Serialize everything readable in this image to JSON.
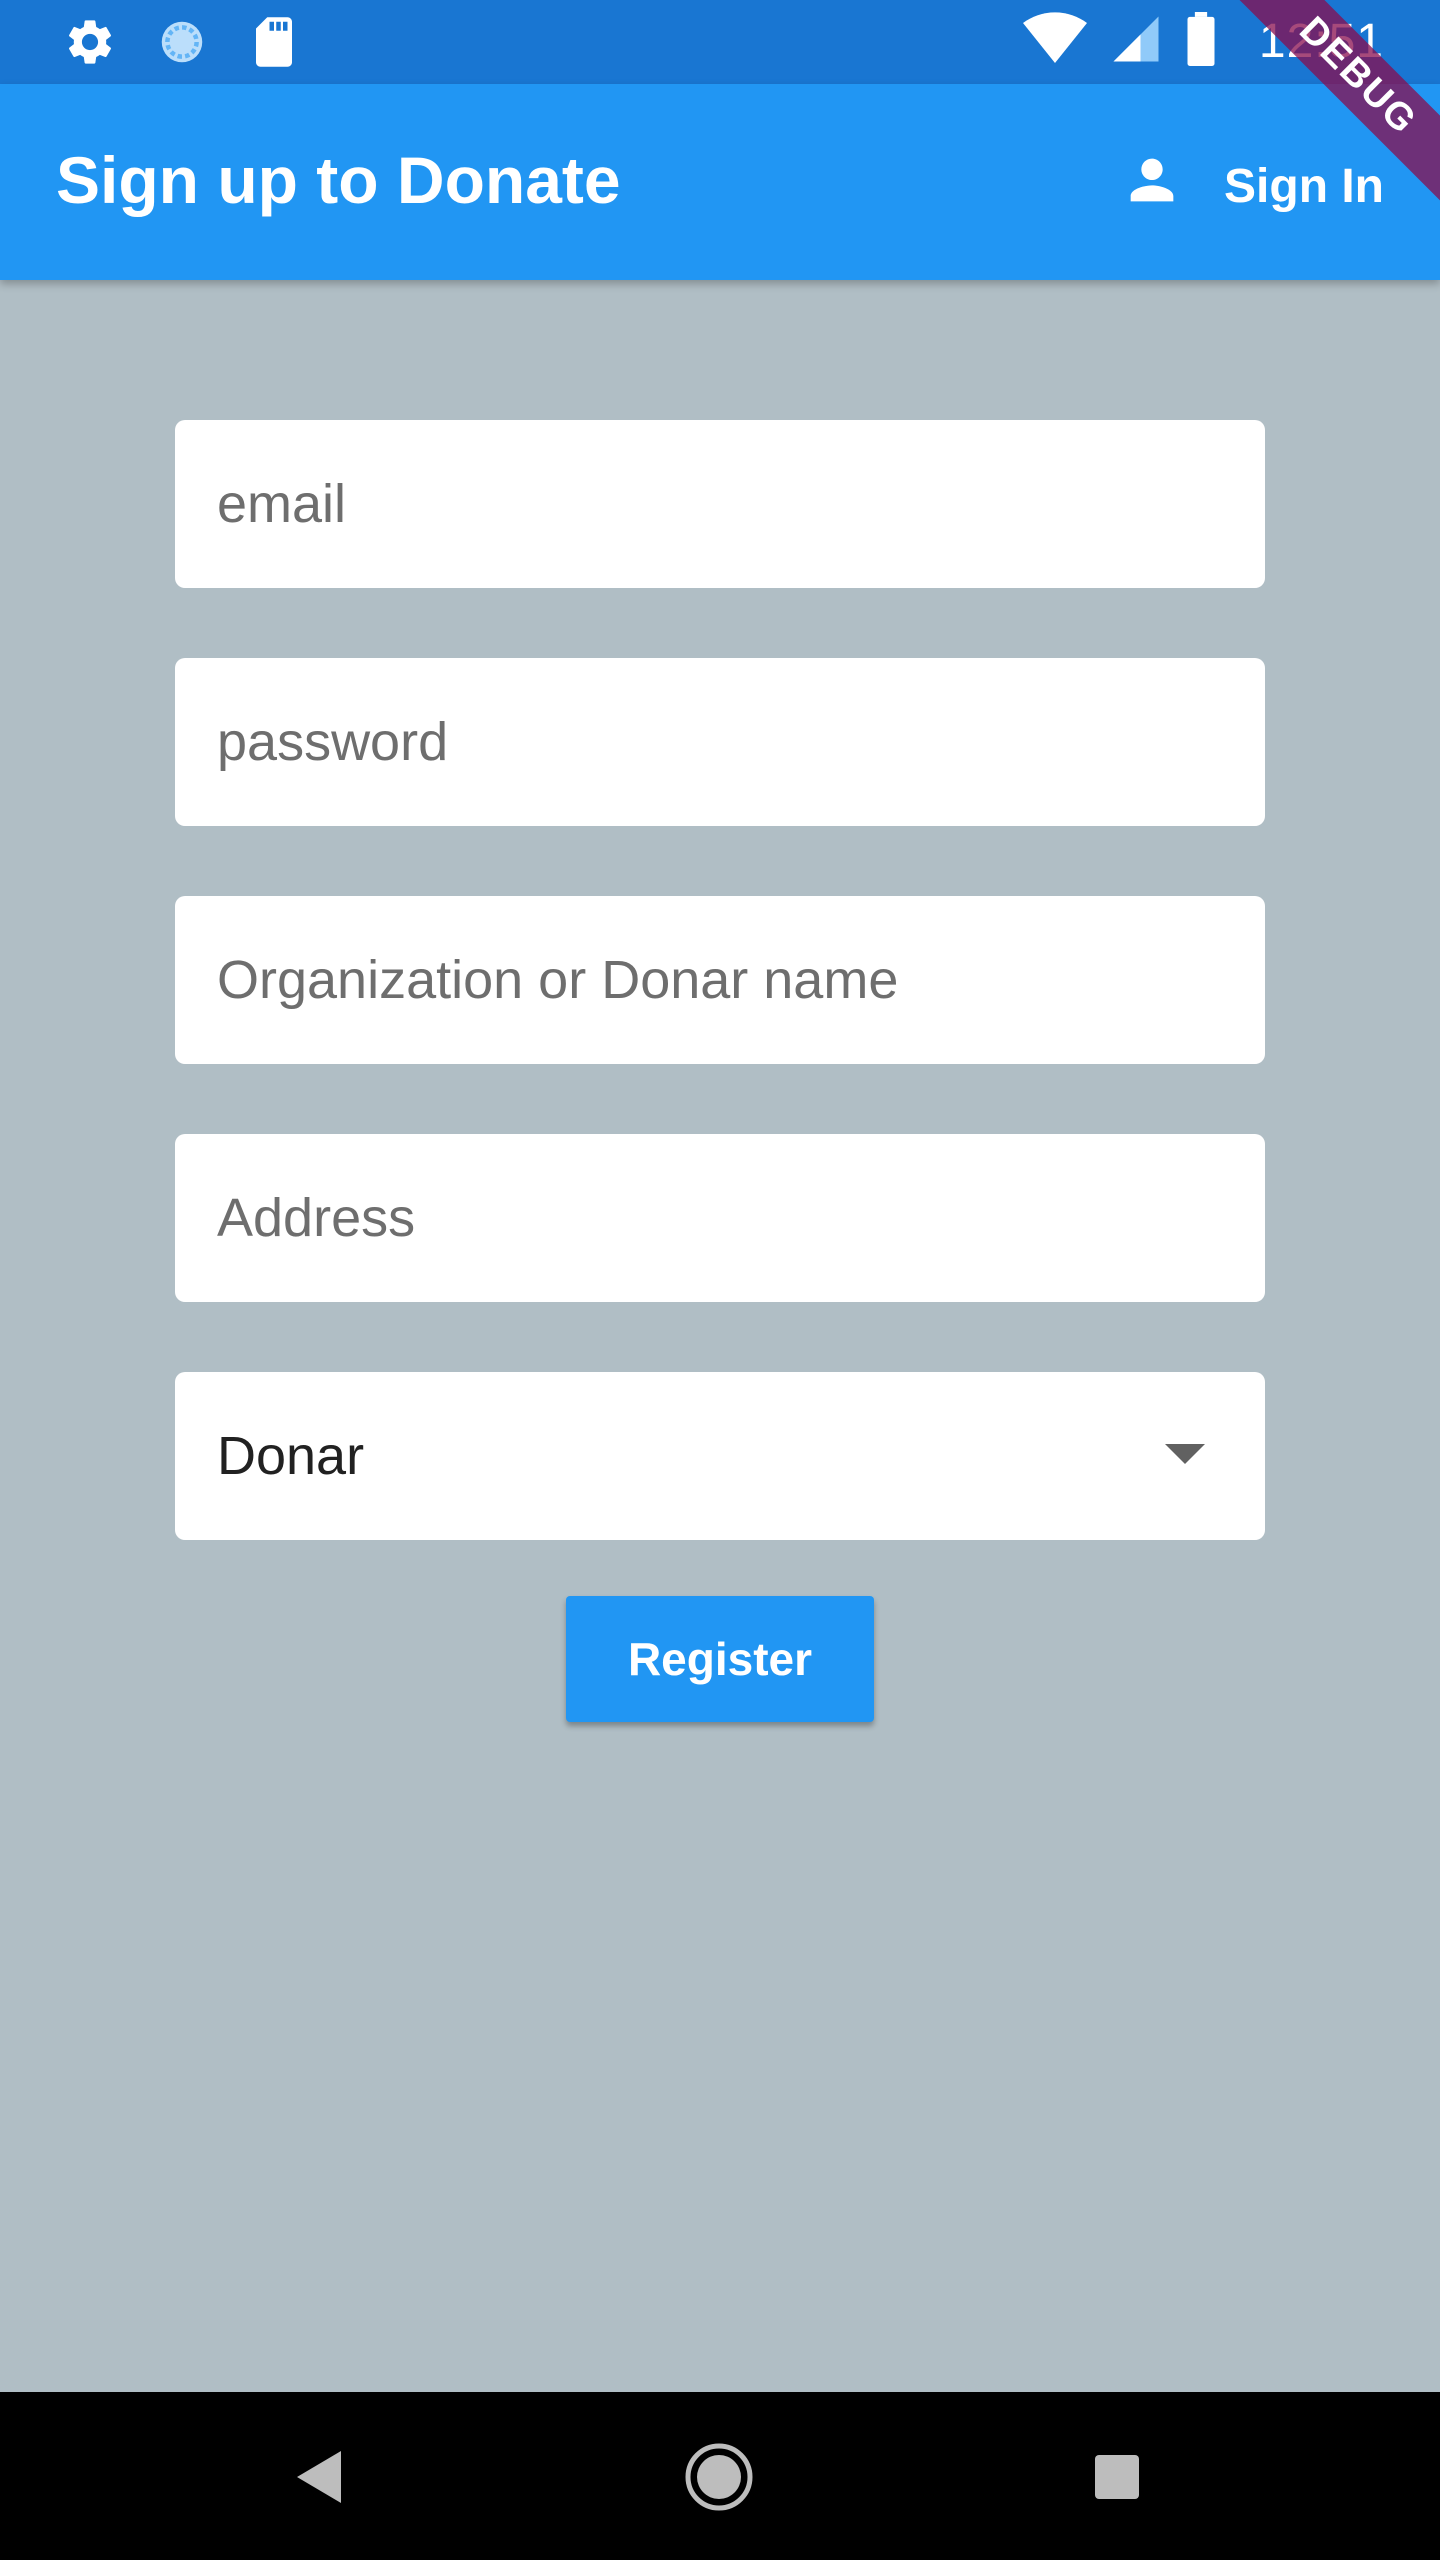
{
  "status_bar": {
    "time": "12:51",
    "icons": [
      "gear-icon",
      "sync-icon",
      "sd-card-icon",
      "wifi-icon",
      "cell-signal-icon",
      "battery-icon"
    ]
  },
  "app_bar": {
    "title": "Sign up to Donate",
    "sign_in_label": "Sign In",
    "sign_in_icon": "person-icon"
  },
  "debug_banner": "DEBUG",
  "form": {
    "email_placeholder": "email",
    "password_placeholder": "password",
    "name_placeholder": "Organization or Donar name",
    "address_placeholder": "Address",
    "role_select_value": "Donar",
    "register_label": "Register"
  },
  "nav_bar": {
    "icons": [
      "back-icon",
      "home-icon",
      "recents-icon"
    ]
  },
  "colors": {
    "status_bar": "#1976d2",
    "app_bar": "#2196f3",
    "background": "#b0bec5",
    "button": "#2196f3",
    "debug_banner": "#880e4f"
  }
}
